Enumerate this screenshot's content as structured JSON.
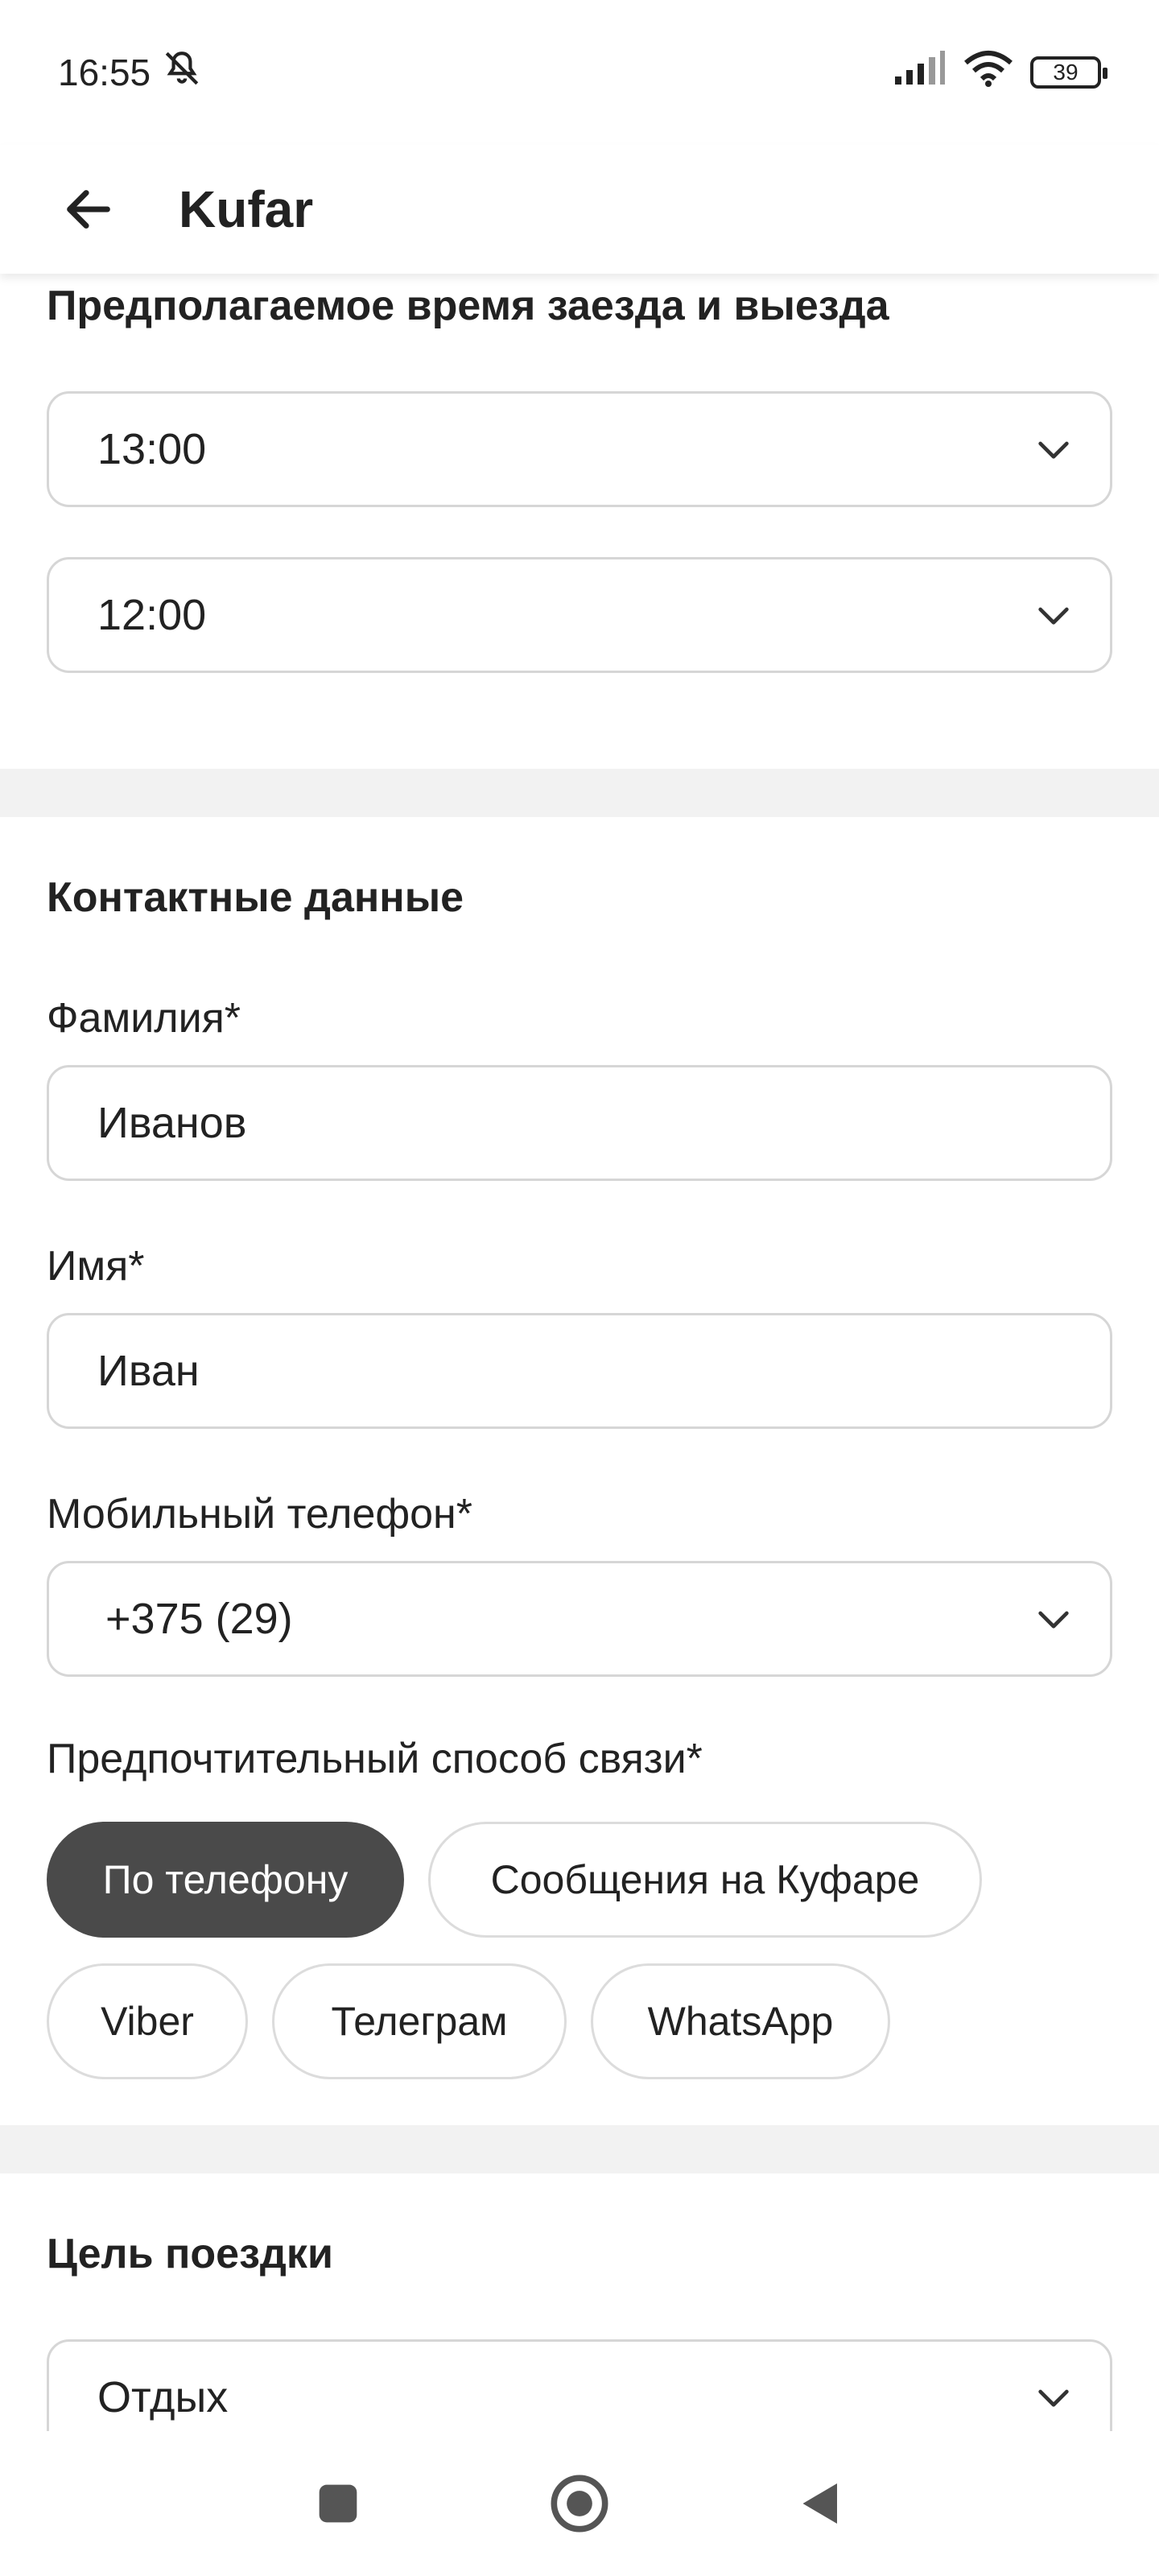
{
  "status": {
    "time": "16:55",
    "battery": "39"
  },
  "header": {
    "title": "Kufar"
  },
  "times": {
    "title": "Предполагаемое время заезда и выезда",
    "checkin": "13:00",
    "checkout": "12:00"
  },
  "contact": {
    "title": "Контактные данные",
    "surname_label": "Фамилия*",
    "surname_value": "Иванов",
    "name_label": "Имя*",
    "name_value": "Иван",
    "phone_label": "Мобильный телефон*",
    "phone_value": "+375 (29)",
    "method_label": "Предпочтительный способ связи*",
    "methods": [
      "По телефону",
      "Сообщения на Куфаре",
      "Viber",
      "Телеграм",
      "WhatsApp"
    ],
    "selected_method": "По телефону"
  },
  "trip": {
    "title": "Цель поездки",
    "value": "Отдых"
  },
  "icons": {
    "back": "arrow-left-icon",
    "chevron": "chevron-down-icon",
    "nav_square": "square-icon",
    "nav_home": "circle-home-icon",
    "nav_back": "triangle-back-icon"
  },
  "colors": {
    "chip_active": "#4a4a4a",
    "divider": "#f2f2f2"
  }
}
